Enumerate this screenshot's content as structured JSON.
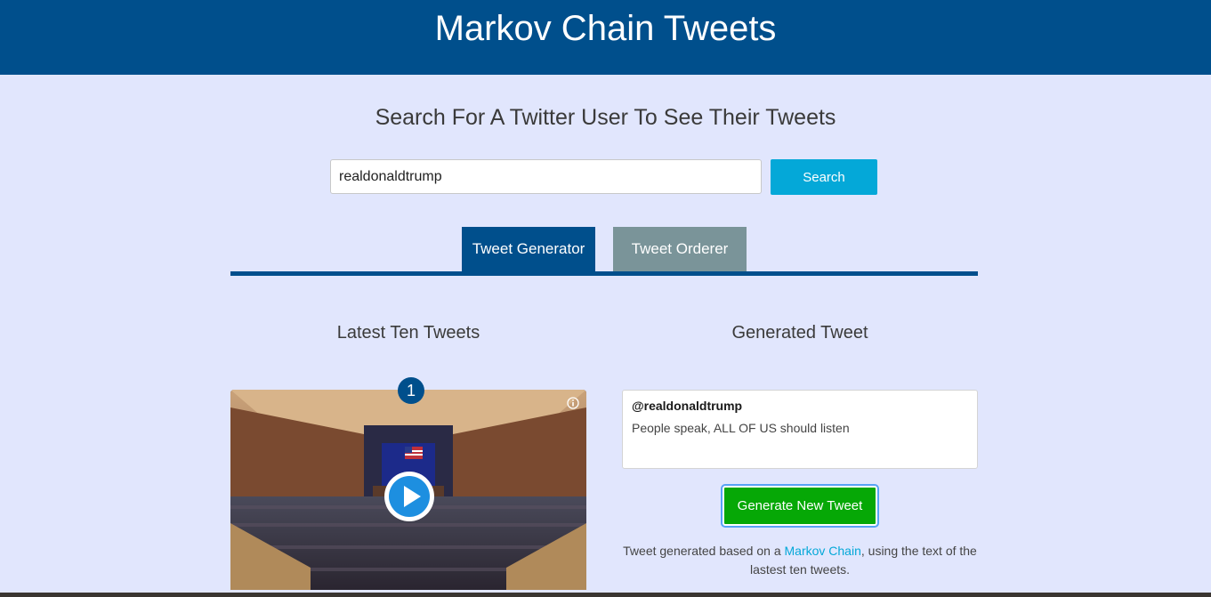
{
  "header": {
    "title": "Markov Chain Tweets"
  },
  "search": {
    "heading": "Search For A Twitter User To See Their Tweets",
    "input_value": "realdonaldtrump",
    "button_label": "Search"
  },
  "tabs": [
    {
      "label": "Tweet Generator",
      "active": true
    },
    {
      "label": "Tweet Orderer",
      "active": false
    }
  ],
  "latest": {
    "heading": "Latest Ten Tweets",
    "items": [
      {
        "index": "1",
        "media": "video-thumbnail"
      }
    ]
  },
  "generated": {
    "heading": "Generated Tweet",
    "handle": "@realdonaldtrump",
    "text": "People speak, ALL OF US should listen",
    "button_label": "Generate New Tweet",
    "note_before": "Tweet generated based on a ",
    "note_link": "Markov Chain",
    "note_after": ", using the text of the lastest ten tweets."
  },
  "colors": {
    "header_bg": "#004f8c",
    "page_bg": "#e1e6fd",
    "search_button": "#04a8d8",
    "tab_active": "#004f8c",
    "tab_inactive": "#7a9499",
    "generate_button": "#06a806"
  }
}
